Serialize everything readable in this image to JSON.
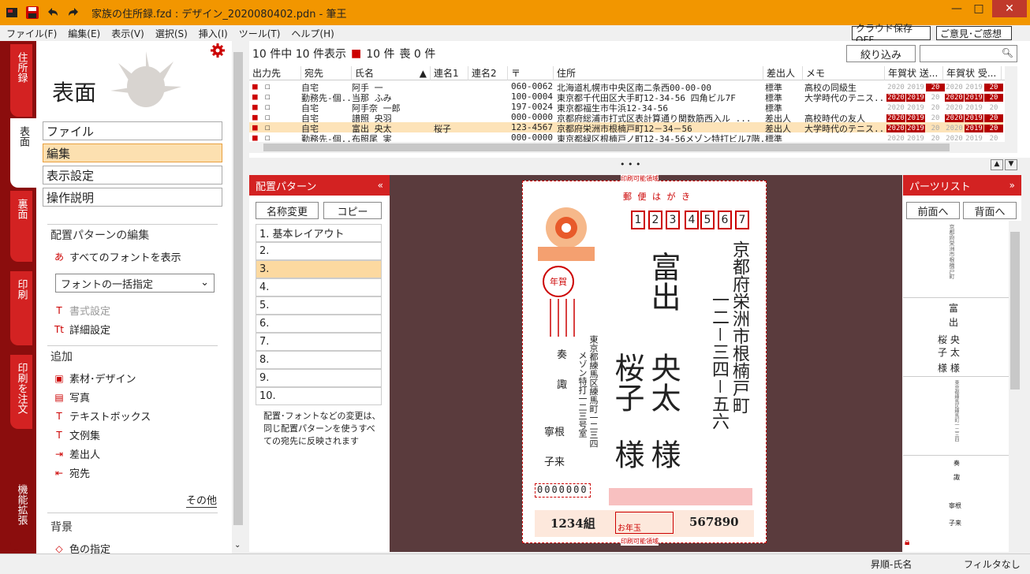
{
  "window": {
    "title": "家族の住所録.fzd : デザイン_2020080402.pdn - 筆王",
    "minimize": "—",
    "maximize": "□",
    "close": "✕"
  },
  "menu": {
    "items": [
      "ファイル(F)",
      "編集(E)",
      "表示(V)",
      "選択(S)",
      "挿入(I)",
      "ツール(T)",
      "ヘルプ(H)"
    ],
    "cloud_save": "クラウド保存OFF",
    "feedback": "ご意見･ご感想"
  },
  "left_tabs": [
    "住所録",
    "表面",
    "裏面",
    "印刷",
    "印刷を注文",
    "機能拡張"
  ],
  "left_panel": {
    "title": "表面",
    "buttons": [
      "ファイル",
      "編集",
      "表示設定",
      "操作説明"
    ],
    "pattern_edit_heading": "配置パターンの編集",
    "show_all_fonts": "すべてのフォントを表示",
    "font_dropdown": "フォントの一括指定",
    "format_setting": "書式設定",
    "detail_setting": "詳細設定",
    "add_heading": "追加",
    "add_items": [
      "素材･デザイン",
      "写真",
      "テキストボックス",
      "文例集",
      "差出人",
      "宛先"
    ],
    "other_link": "その他",
    "bg_heading": "背景",
    "color_item": "色の指定"
  },
  "list": {
    "summary": "10 件中 10 件表示",
    "print_count": "10 件",
    "mourning_count": "喪 0 件",
    "filter_button": "絞り込み",
    "columns": [
      "出力先",
      "宛先",
      "氏名",
      "連名1",
      "連名2",
      "〒",
      "住所",
      "差出人",
      "メモ",
      "年賀状 送...",
      "年賀状 受...",
      "1"
    ],
    "rows": [
      {
        "type": "自宅",
        "name": "阿手 一",
        "ren1": "",
        "zip": "060-0062",
        "addr": "北海道札幌市中央区南二条西00-00-00",
        "sender": "標準",
        "memo": "高校の同級生",
        "sent": [
          0,
          0,
          1
        ],
        "recv": [
          0,
          0,
          1
        ]
      },
      {
        "type": "勤務先-個...",
        "name": "当那 ふみ",
        "ren1": "",
        "zip": "100-0004",
        "addr": "東京都千代田区大手町12-34-56 四角ビル7F",
        "sender": "標準",
        "memo": "大学時代のテニス...",
        "sent": [
          1,
          1,
          0
        ],
        "recv": [
          1,
          1,
          1
        ]
      },
      {
        "type": "自宅",
        "name": "阿手奈 一郎",
        "ren1": "",
        "zip": "197-0024",
        "addr": "東京都福生市牛浜12-34-56",
        "sender": "標準",
        "memo": "",
        "sent": [
          0,
          0,
          0
        ],
        "recv": [
          0,
          0,
          0
        ]
      },
      {
        "type": "自宅",
        "name": "譜照 央羽",
        "ren1": "",
        "zip": "000-0000",
        "addr": "京都府総浦市打式区表計算通り関数筋西入ル ...",
        "sender": "差出人",
        "memo": "高校時代の友人",
        "sent": [
          1,
          1,
          0
        ],
        "recv": [
          1,
          1,
          1
        ]
      },
      {
        "type": "自宅",
        "name": "富出 央太",
        "ren1": "桜子",
        "zip": "123-4567",
        "addr": "京都府栄洲市根楠戸町12－34－56",
        "sender": "差出人",
        "memo": "大学時代のテニス...",
        "sent": [
          1,
          1,
          0
        ],
        "recv": [
          0,
          1,
          1
        ]
      },
      {
        "type": "勤務先-個...",
        "name": "布照尾 実",
        "ren1": "",
        "zip": "000-0000",
        "addr": "東京都緑区根楠戸ノ町12-34-56メゾン特打ビル7階...",
        "sender": "標準",
        "memo": "",
        "sent": [
          0,
          0,
          0
        ],
        "recv": [
          0,
          0,
          0
        ]
      }
    ],
    "years": [
      "2020",
      "2019",
      "20"
    ]
  },
  "divider_dots": "• • •",
  "pattern_panel": {
    "title": "配置パターン",
    "rename": "名称変更",
    "copy": "コピー",
    "items": [
      "1. 基本レイアウト",
      "2.",
      "3.",
      "4.",
      "5.",
      "6.",
      "7.",
      "8.",
      "9.",
      "10."
    ],
    "note": "配置･フォントなどの変更は、同じ配置パターンを使うすべての宛先に反映されます"
  },
  "card": {
    "top_label": "印刷可能領域",
    "postcard_label": "郵 便 は が き",
    "zip_digits": [
      "1",
      "2",
      "3",
      "4",
      "5",
      "6",
      "7"
    ],
    "address": "京都府栄洲市根楠戸町",
    "address2": "一二－三四－五六",
    "name_surname": "富出",
    "name_given1": "央太",
    "name_given2": "桜子",
    "honorific": "様",
    "sender_addr": "東京都練馬区練馬町一二三四",
    "sender_addr2": "メゾン特打一二三号室",
    "sender_name1": "奏",
    "sender_name2": "諏",
    "sender_name3": "寧根",
    "sender_name4": "子来",
    "sender_zip": "0000000",
    "lottery_group": "1234組",
    "lottery_label": "お年玉",
    "lottery_num": "567890",
    "bottom_label": "印刷可能領域",
    "stamp_text": "年賀"
  },
  "parts_panel": {
    "title": "パーツリスト",
    "front": "前面へ",
    "back": "背面へ",
    "thumb2": [
      "富",
      "出",
      "桜 央",
      "子 太",
      "様 様"
    ]
  },
  "status": {
    "sort": "昇順-氏名",
    "filter": "フィルタなし"
  },
  "colors": {
    "accent": "#f29600",
    "tab_red": "#d32222",
    "dark_red": "#8b0d0d",
    "selection": "#fde3b8"
  }
}
